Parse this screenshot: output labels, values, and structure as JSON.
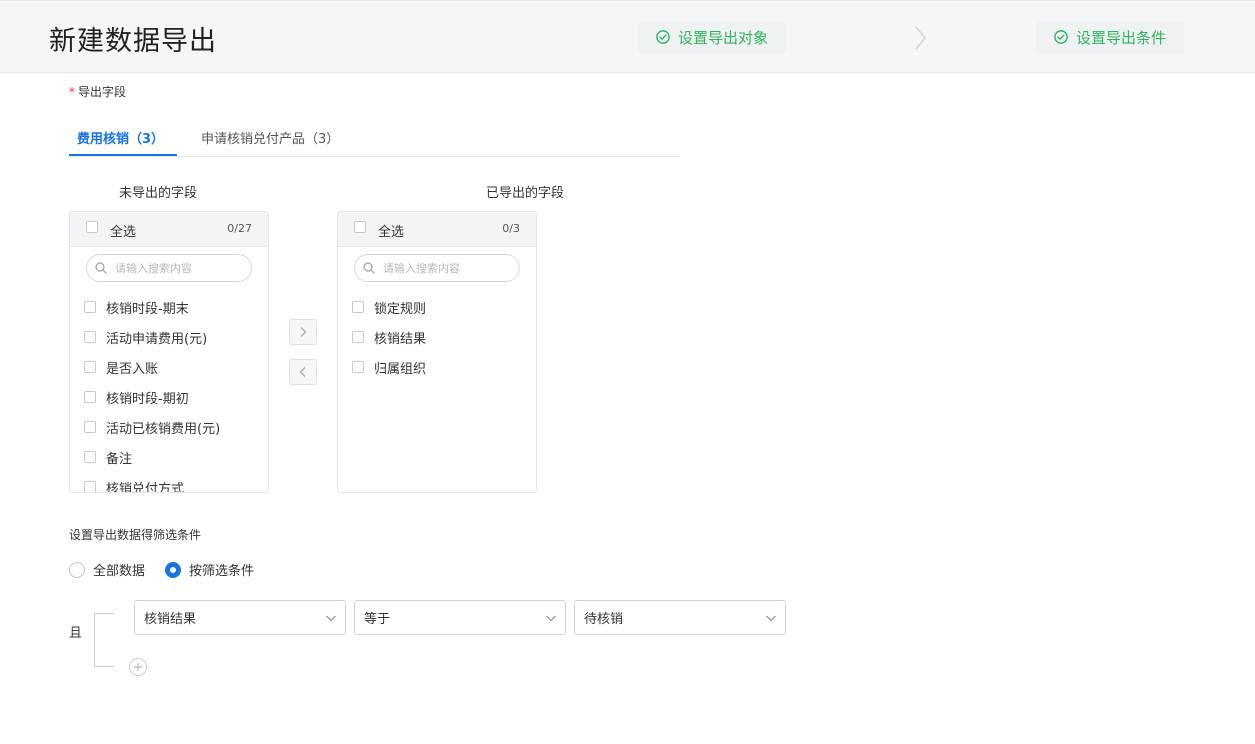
{
  "header": {
    "title": "新建数据导出",
    "steps": [
      {
        "label": "设置导出对象"
      },
      {
        "label": "设置导出条件"
      }
    ]
  },
  "fields_section": {
    "label": "导出字段",
    "tabs": [
      {
        "label": "费用核销（3）"
      },
      {
        "label": "申请核销兑付产品（3）"
      }
    ],
    "left_title": "未导出的字段",
    "right_title": "已导出的字段",
    "left_panel": {
      "select_all": "全选",
      "count": "0/27",
      "search_placeholder": "请输入搜索内容",
      "items": [
        "核销时段-期末",
        "活动申请费用(元)",
        "是否入账",
        "核销时段-期初",
        "活动已核销费用(元)",
        "备注",
        "核销兑付方式"
      ]
    },
    "right_panel": {
      "select_all": "全选",
      "count": "0/3",
      "search_placeholder": "请输入搜索内容",
      "items": [
        "锁定规则",
        "核销结果",
        "归属组织"
      ]
    }
  },
  "filter_section": {
    "title": "设置导出数据得筛选条件",
    "radios": [
      {
        "label": "全部数据",
        "checked": false
      },
      {
        "label": "按筛选条件",
        "checked": true
      }
    ],
    "and_label": "且",
    "condition": {
      "field": "核销结果",
      "operator": "等于",
      "value": "待核销"
    }
  },
  "colors": {
    "accent": "#1773e6",
    "success": "#2db55d",
    "required": "#e33333"
  }
}
